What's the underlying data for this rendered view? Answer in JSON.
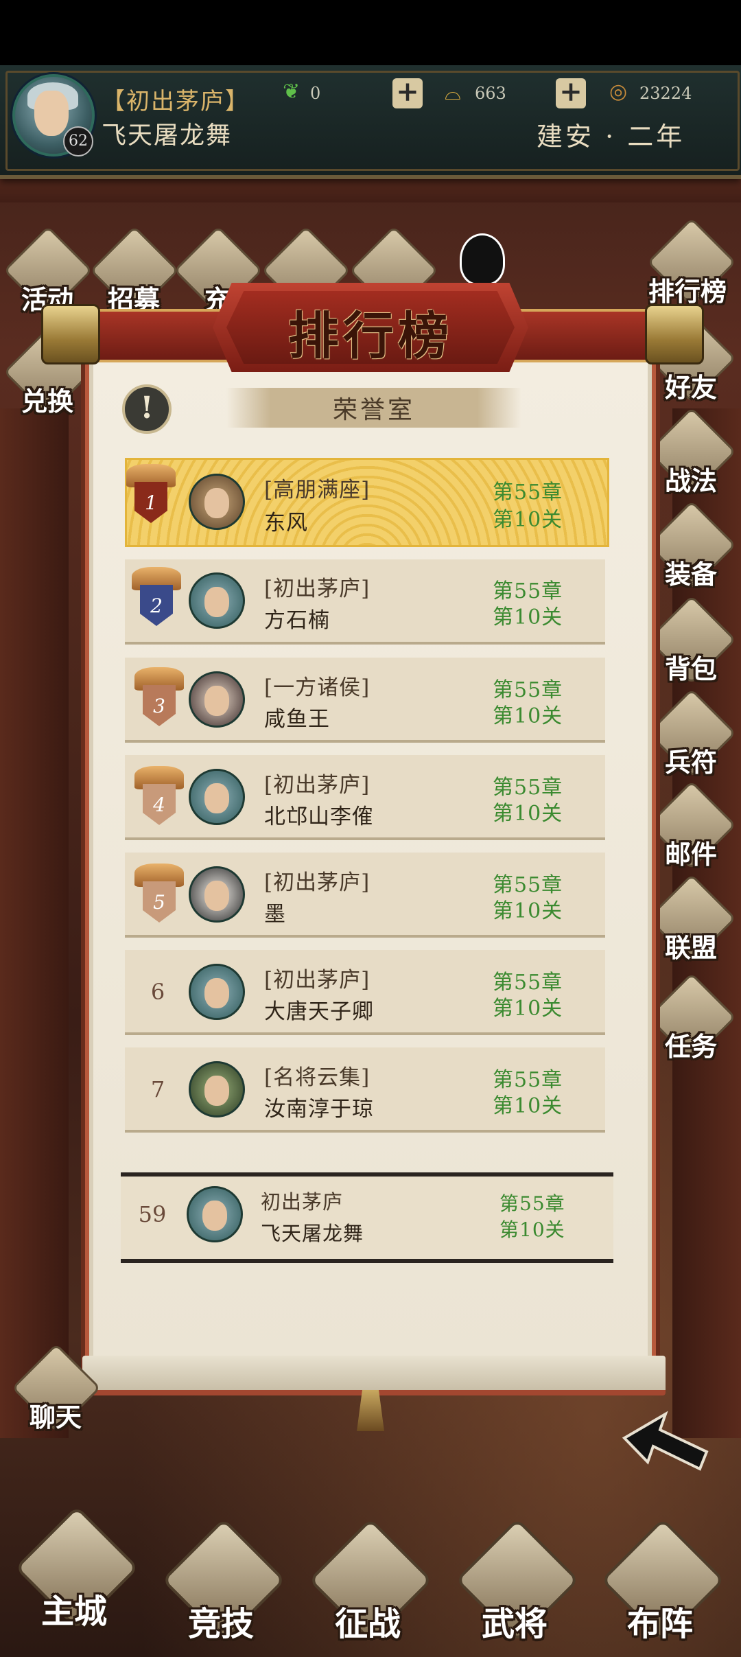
{
  "header": {
    "player_title": "【初出茅庐】",
    "player_name": "飞天屠龙舞",
    "level": "62",
    "jade": "0",
    "ingot": "663",
    "coins": "23224",
    "era": "建安 · 二年"
  },
  "left_menu": [
    {
      "label": "活动",
      "icon": "gift-bag-icon"
    },
    {
      "label": "招募",
      "icon": "scroll-icon"
    },
    {
      "label": "充",
      "icon": "pouch-icon"
    },
    {
      "label": "兑换",
      "icon": "exchange-icon"
    }
  ],
  "right_menu": [
    {
      "label": "排行榜",
      "icon": "ranking-icon"
    },
    {
      "label": "好友",
      "icon": "friends-icon"
    },
    {
      "label": "战法",
      "icon": "tactics-book-icon"
    },
    {
      "label": "装备",
      "icon": "sword-icon"
    },
    {
      "label": "背包",
      "icon": "backpack-icon"
    },
    {
      "label": "兵符",
      "icon": "tally-icon"
    },
    {
      "label": "邮件",
      "icon": "mail-icon"
    },
    {
      "label": "联盟",
      "icon": "alliance-icon"
    },
    {
      "label": "任务",
      "icon": "task-scroll-icon"
    }
  ],
  "panel": {
    "title": "排行榜",
    "subtab": "荣誉室",
    "info_icon": "!"
  },
  "ranking": [
    {
      "rank": "1",
      "title": "[高朋满座]",
      "name": "东风",
      "chapter": "第55章",
      "stage": "第10关"
    },
    {
      "rank": "2",
      "title": "[初出茅庐]",
      "name": "方石楠",
      "chapter": "第55章",
      "stage": "第10关"
    },
    {
      "rank": "3",
      "title": "[一方诸侯]",
      "name": "咸鱼王",
      "chapter": "第55章",
      "stage": "第10关"
    },
    {
      "rank": "4",
      "title": "[初出茅庐]",
      "name": "北邙山李傕",
      "chapter": "第55章",
      "stage": "第10关"
    },
    {
      "rank": "5",
      "title": "[初出茅庐]",
      "name": "墨",
      "chapter": "第55章",
      "stage": "第10关"
    },
    {
      "rank": "6",
      "title": "[初出茅庐]",
      "name": "大唐天子卿",
      "chapter": "第55章",
      "stage": "第10关"
    },
    {
      "rank": "7",
      "title": "[名将云集]",
      "name": "汝南淳于琼",
      "chapter": "第55章",
      "stage": "第10关"
    }
  ],
  "my_rank": {
    "rank": "59",
    "title": "初出茅庐",
    "name": "飞天屠龙舞",
    "chapter": "第55章",
    "stage": "第10关"
  },
  "chat": {
    "label": "聊天"
  },
  "bottom_nav": [
    {
      "label": "主城",
      "icon": "palace-icon"
    },
    {
      "label": "竞技",
      "icon": "crossed-swords-icon"
    },
    {
      "label": "征战",
      "icon": "war-horn-icon"
    },
    {
      "label": "武将",
      "icon": "general-icon"
    },
    {
      "label": "布阵",
      "icon": "go-board-icon"
    }
  ],
  "colors": {
    "chapter_green": "#3b8a30",
    "banner_red": "#a32d20",
    "gold": "#e3b43a"
  }
}
